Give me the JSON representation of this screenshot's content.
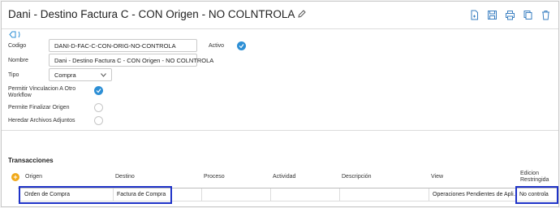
{
  "header": {
    "title": "Dani - Destino Factura C - CON Origen - NO COLNTROLA",
    "toolbar": [
      "new-document-icon",
      "save-icon",
      "print-icon",
      "copy-icon",
      "delete-icon"
    ]
  },
  "form": {
    "codigo_label": "Codigo",
    "codigo_value": "DANI-D-FAC-C-CON-ORIG-NO-CONTROLA",
    "nombre_label": "Nombre",
    "nombre_value": "Dani - Destino Factura C - CON Origen - NO COLNTROLA",
    "tipo_label": "Tipo",
    "tipo_value": "Compra",
    "activo_label": "Activo",
    "activo_checked": true,
    "permitir_label_1": "Permitir Vinculacion A Otro",
    "permitir_label_2": "Workflow",
    "permitir_checked": true,
    "finalizar_label": "Permite Finalizar Origen",
    "finalizar_checked": false,
    "heredar_label": "Heredar Archivos Adjuntos",
    "heredar_checked": false
  },
  "transacciones": {
    "title": "Transacciones",
    "columns": {
      "origen": "Origen",
      "destino": "Destino",
      "proceso": "Proceso",
      "actividad": "Actividad",
      "descripcion": "Descripción",
      "view": "View",
      "edicion_1": "Edicion",
      "edicion_2": "Restringida"
    },
    "rows": [
      {
        "origen": "Orden de Compra",
        "destino": "Factura de Compra",
        "proceso": "",
        "actividad": "",
        "descripcion": "",
        "view": "Operaciones Pendientes de Apli…",
        "edicion": "No controla"
      }
    ]
  },
  "colors": {
    "accent": "#2d8fd5",
    "highlight": "#1f33c8",
    "add": "#f0a818"
  }
}
